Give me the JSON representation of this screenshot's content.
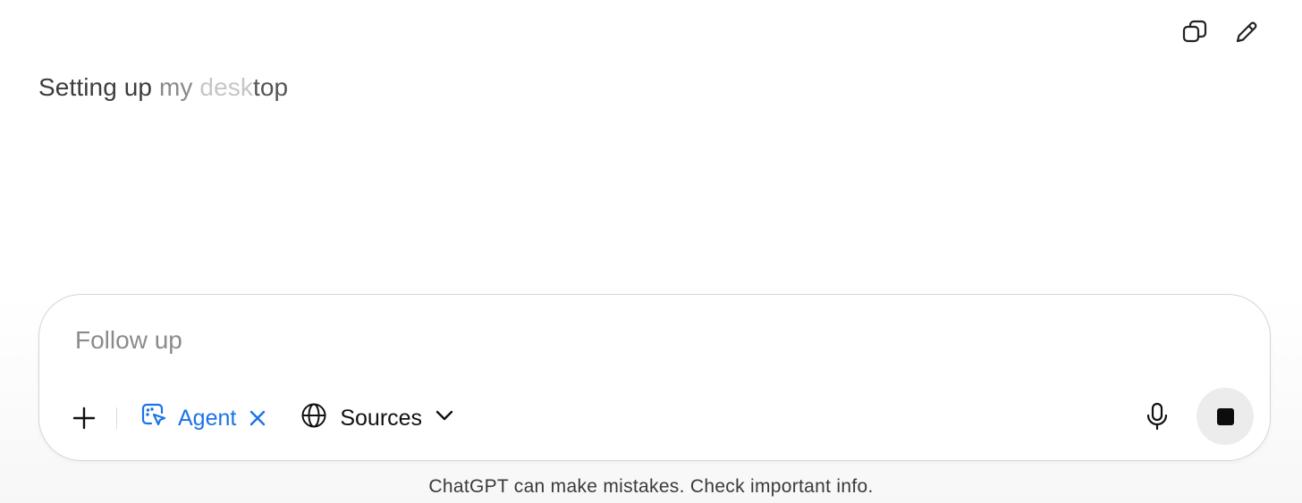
{
  "header": {
    "actions": [
      {
        "name": "copy-icon"
      },
      {
        "name": "edit-icon"
      }
    ]
  },
  "status": {
    "part1": "Setting up ",
    "part2": "my ",
    "part3": "desk",
    "part4": "top"
  },
  "composer": {
    "placeholder": "Follow up",
    "value": "",
    "plus_icon": "plus-icon",
    "agent_label": "Agent",
    "agent_icon": "agent-cursor-icon",
    "sources_label": "Sources",
    "sources_icon": "globe-icon",
    "mic_icon": "microphone-icon",
    "stop_icon": "stop-icon"
  },
  "footer": {
    "disclaimer": "ChatGPT can make mistakes. Check important info."
  },
  "colors": {
    "accent": "#1a73e8",
    "text": "#3d3d3d",
    "stop_bg": "#ececec"
  }
}
